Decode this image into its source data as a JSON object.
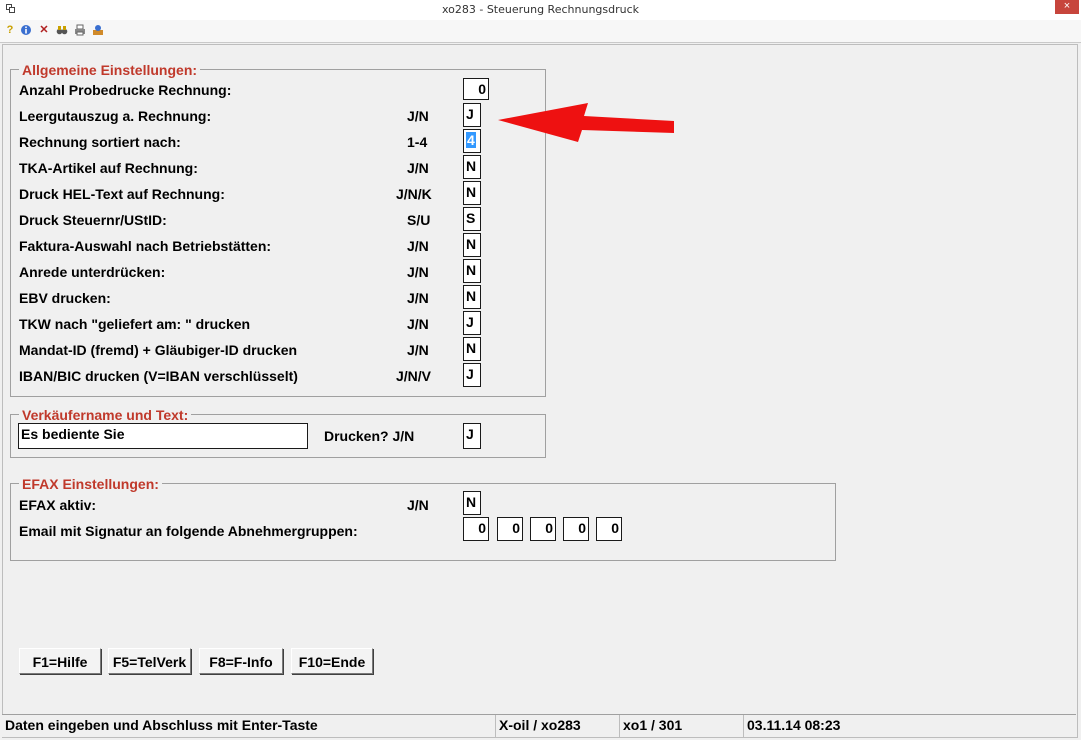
{
  "window": {
    "title": "xo283 - Steuerung Rechnungsdruck",
    "close_label": "×"
  },
  "toolbar_icons": [
    "help-icon",
    "info-icon",
    "cancel-icon",
    "binoculars-icon",
    "print-icon",
    "tools-icon"
  ],
  "general": {
    "title": "Allgemeine Einstellungen:",
    "rows": [
      {
        "label": "Anzahl Probedrucke Rechnung:",
        "format": "",
        "value": "0"
      },
      {
        "label": "Leergutauszug a. Rechnung:",
        "format": "J/N",
        "value": "J"
      },
      {
        "label": "Rechnung sortiert nach:",
        "format": "1-4",
        "value": "4"
      },
      {
        "label": "TKA-Artikel auf Rechnung:",
        "format": "J/N",
        "value": "N"
      },
      {
        "label": "Druck HEL-Text auf Rechnung:",
        "format": "J/N/K",
        "value": "N"
      },
      {
        "label": "Druck Steuernr/UStID:",
        "format": "S/U",
        "value": "S"
      },
      {
        "label": "Faktura-Auswahl nach Betriebstätten:",
        "format": "J/N",
        "value": "N"
      },
      {
        "label": "Anrede unterdrücken:",
        "format": "J/N",
        "value": "N"
      },
      {
        "label": "EBV drucken:",
        "format": "J/N",
        "value": "N"
      },
      {
        "label": "TKW nach \"geliefert am: \" drucken",
        "format": "J/N",
        "value": "J"
      },
      {
        "label": "Mandat-ID (fremd) + Gläubiger-ID drucken",
        "format": "J/N",
        "value": "N"
      },
      {
        "label": "IBAN/BIC drucken  (V=IBAN verschlüsselt)",
        "format": "J/N/V",
        "value": "J"
      }
    ]
  },
  "seller": {
    "title": "Verkäufername und Text:",
    "text_value": "Es bediente Sie",
    "print_label": "Drucken? J/N",
    "print_value": "J"
  },
  "efax": {
    "title": "EFAX Einstellungen:",
    "active_label": "EFAX aktiv:",
    "active_format": "J/N",
    "active_value": "N",
    "groups_label": "Email mit Signatur an folgende Abnehmergruppen:",
    "groups": [
      "0",
      "0",
      "0",
      "0",
      "0"
    ]
  },
  "fkeys": [
    {
      "label": "F1=Hilfe"
    },
    {
      "label": "F5=TelVerk"
    },
    {
      "label": "F8=F-Info"
    },
    {
      "label": "F10=Ende"
    }
  ],
  "status": {
    "message": "Daten eingeben und Abschluss mit Enter-Taste",
    "program": "X-oil / xo283",
    "user": "xo1 / 301",
    "datetime": "03.11.14 08:23"
  },
  "colors": {
    "group_title": "#c0392b",
    "arrow": "#ee1111",
    "selection": "#3399ff"
  }
}
